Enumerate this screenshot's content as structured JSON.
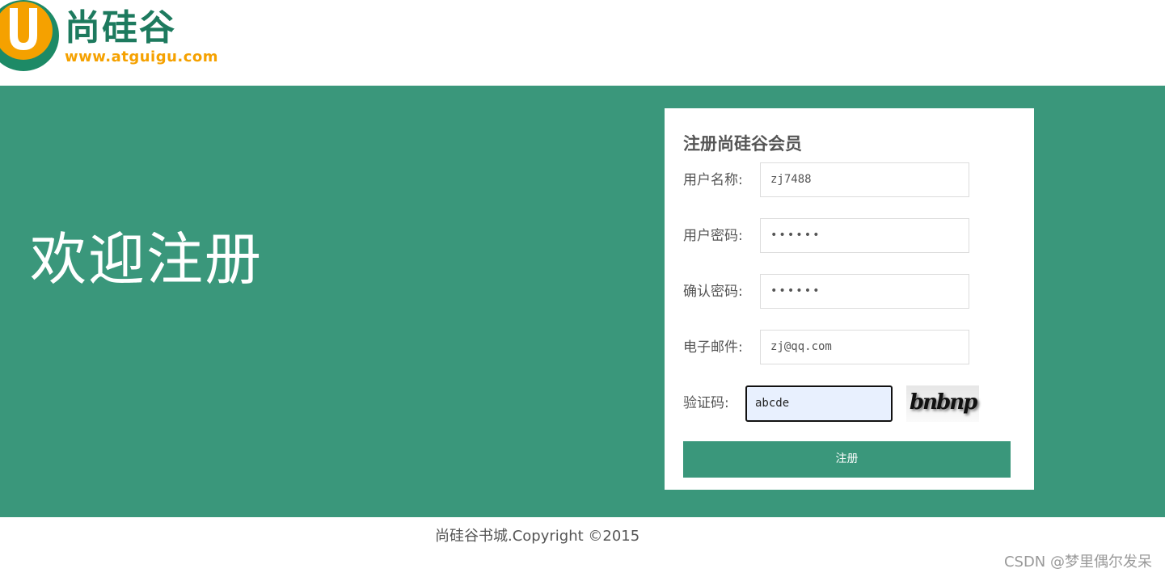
{
  "header": {
    "logo_text": "尚硅谷",
    "logo_url": "www.atguigu.com",
    "logo_letter": "U"
  },
  "banner": {
    "welcome": "欢迎注册"
  },
  "form": {
    "title": "注册尚硅谷会员",
    "fields": [
      {
        "label": "用户名称:",
        "value": "zj7488"
      },
      {
        "label": "用户密码:",
        "value": "••••••"
      },
      {
        "label": "确认密码:",
        "value": "••••••"
      },
      {
        "label": "电子邮件:",
        "value": "zj@qq.com"
      }
    ],
    "captcha": {
      "label": "验证码:",
      "value": "abcde",
      "image_text": "bnbnp"
    },
    "submit_label": "注册"
  },
  "footer": {
    "copyright": "尚硅谷书城.Copyright ©2015"
  },
  "watermark": "CSDN @梦里偶尔发呆",
  "colors": {
    "brand_green": "#3a977b",
    "logo_green": "#1d7a5e",
    "logo_orange": "#f5a100"
  }
}
